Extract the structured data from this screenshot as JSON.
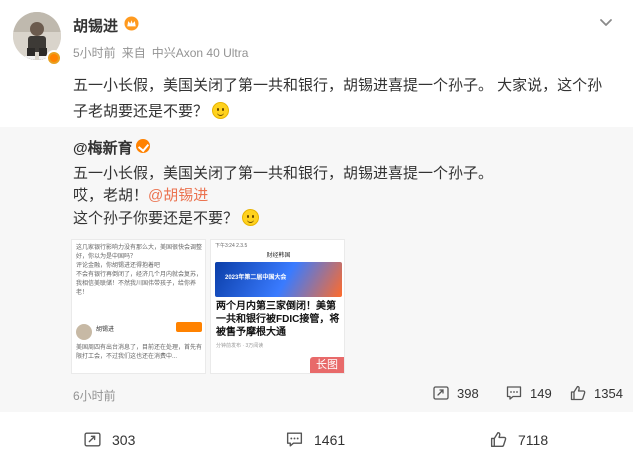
{
  "post": {
    "author": "胡锡进",
    "time": "5小时前",
    "source_prefix": "来自",
    "source_device": "中兴Axon 40 Ultra",
    "text": "五一小长假，美国关闭了第一共和银行，胡锡进喜提一个孙子。 大家说，这个孙子老胡要还是不要？",
    "icons": {
      "vip": "vip-crown-icon",
      "more": "chevron-down-icon",
      "verified": "verified-badge-icon"
    }
  },
  "repost": {
    "author": "@梅新育",
    "line1": "五一小长假，美国关闭了第一共和银行，胡锡进喜提一个孙子。",
    "line2_prefix": "哎，老胡！",
    "line2_mention": "@胡锡进",
    "line3": "这个孙子你要还是不要？",
    "time": "6小时前",
    "image1": {
      "caption": "这几家银行影响力没有那么大，美国很快会调整好，你以为是中国吗？\n评论金融，你胡锡进还得抱着吧\n不会有银行再倒闭了，经济几个月内就会复苏，我相信美联储！不然我川国伟带孩子，给你养老！",
      "name": "胡锡进",
      "body": "美国周四有出台消息了，目前还在处理，首先有限打工会，不过我们这也还在消费中..."
    },
    "image2": {
      "status_time": "下午3:24 2.3.5",
      "title": "财经韩国",
      "banner": "2023年第二届中国大会",
      "headline": "两个月内第三家倒闭！美第一共和银行被FDIC接管，将被售予摩根大通",
      "sub": "分钟前发布 · 3万阅读",
      "long_tag": "长图"
    },
    "actions": {
      "forward": "398",
      "comment": "149",
      "like": "1354"
    }
  },
  "footer": {
    "forward": "303",
    "comment": "1461",
    "like": "7118"
  }
}
